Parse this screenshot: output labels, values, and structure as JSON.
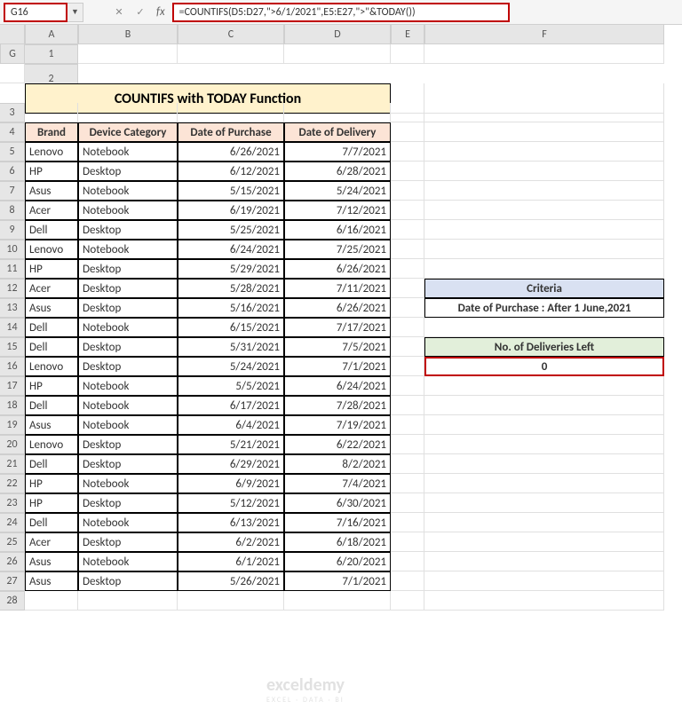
{
  "nameBox": "G16",
  "formula": "=COUNTIFS(D5:D27,\">6/1/2021\",E5:E27,\">\"&TODAY())",
  "columnHeaders": [
    "A",
    "B",
    "C",
    "D",
    "E",
    "F",
    "G"
  ],
  "rowCount": 28,
  "title": "COUNTIFS with TODAY Function",
  "tableHeaders": [
    "Brand",
    "Device Category",
    "Date of Purchase",
    "Date of Delivery"
  ],
  "rows": [
    {
      "brand": "Lenovo",
      "cat": "Notebook",
      "pur": "6/26/2021",
      "del": "7/7/2021"
    },
    {
      "brand": "HP",
      "cat": "Desktop",
      "pur": "6/12/2021",
      "del": "6/28/2021"
    },
    {
      "brand": "Asus",
      "cat": "Notebook",
      "pur": "5/15/2021",
      "del": "5/24/2021"
    },
    {
      "brand": "Acer",
      "cat": "Notebook",
      "pur": "6/19/2021",
      "del": "7/12/2021"
    },
    {
      "brand": "Dell",
      "cat": "Desktop",
      "pur": "5/25/2021",
      "del": "6/16/2021"
    },
    {
      "brand": "Lenovo",
      "cat": "Notebook",
      "pur": "6/24/2021",
      "del": "7/25/2021"
    },
    {
      "brand": "HP",
      "cat": "Desktop",
      "pur": "5/29/2021",
      "del": "6/26/2021"
    },
    {
      "brand": "Acer",
      "cat": "Desktop",
      "pur": "5/28/2021",
      "del": "7/11/2021"
    },
    {
      "brand": "Asus",
      "cat": "Desktop",
      "pur": "5/16/2021",
      "del": "6/26/2021"
    },
    {
      "brand": "Dell",
      "cat": "Notebook",
      "pur": "6/15/2021",
      "del": "7/17/2021"
    },
    {
      "brand": "Dell",
      "cat": "Desktop",
      "pur": "5/31/2021",
      "del": "7/5/2021"
    },
    {
      "brand": "Lenovo",
      "cat": "Desktop",
      "pur": "5/24/2021",
      "del": "7/1/2021"
    },
    {
      "brand": "HP",
      "cat": "Notebook",
      "pur": "5/5/2021",
      "del": "6/24/2021"
    },
    {
      "brand": "Dell",
      "cat": "Notebook",
      "pur": "6/17/2021",
      "del": "7/28/2021"
    },
    {
      "brand": "Asus",
      "cat": "Notebook",
      "pur": "6/4/2021",
      "del": "7/19/2021"
    },
    {
      "brand": "Lenovo",
      "cat": "Desktop",
      "pur": "5/21/2021",
      "del": "6/22/2021"
    },
    {
      "brand": "Dell",
      "cat": "Desktop",
      "pur": "6/29/2021",
      "del": "8/2/2021"
    },
    {
      "brand": "HP",
      "cat": "Notebook",
      "pur": "6/9/2021",
      "del": "7/4/2021"
    },
    {
      "brand": "HP",
      "cat": "Desktop",
      "pur": "5/12/2021",
      "del": "6/30/2021"
    },
    {
      "brand": "Dell",
      "cat": "Notebook",
      "pur": "6/13/2021",
      "del": "7/16/2021"
    },
    {
      "brand": "Acer",
      "cat": "Desktop",
      "pur": "6/2/2021",
      "del": "6/18/2021"
    },
    {
      "brand": "Asus",
      "cat": "Notebook",
      "pur": "6/1/2021",
      "del": "6/20/2021"
    },
    {
      "brand": "Asus",
      "cat": "Desktop",
      "pur": "5/26/2021",
      "del": "7/1/2021"
    }
  ],
  "criteriaHeader": "Criteria",
  "criteriaValue": "Date of Purchase : After 1 June,2021",
  "deliveriesHeader": "No. of Deliveries Left",
  "deliveriesValue": "0",
  "watermark": "exceldemy",
  "watermarkSub": "EXCEL · DATA · BI"
}
